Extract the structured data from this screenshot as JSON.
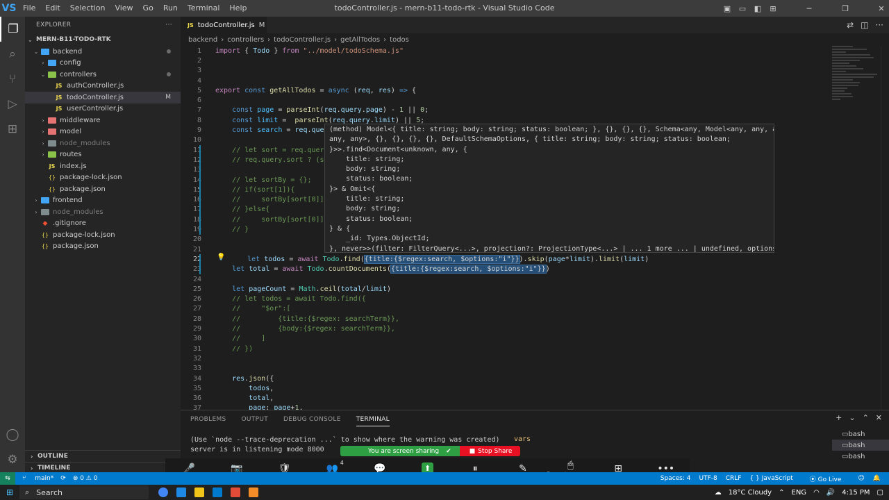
{
  "titlebar": {
    "logo": "VS",
    "menu": [
      "File",
      "Edit",
      "Selection",
      "View",
      "Go",
      "Run",
      "Terminal",
      "Help"
    ],
    "title": "todoController.js - mern-b11-todo-rtk - Visual Studio Code"
  },
  "sidebar": {
    "header": "EXPLORER",
    "root": "MERN-B11-TODO-RTK",
    "tree": [
      {
        "label": "backend",
        "kind": "folder",
        "color": "blue",
        "depth": 1,
        "open": true,
        "dot": true
      },
      {
        "label": "config",
        "kind": "folder",
        "color": "blue",
        "depth": 2,
        "open": false
      },
      {
        "label": "controllers",
        "kind": "folder",
        "color": "green",
        "depth": 2,
        "open": true,
        "dot": true
      },
      {
        "label": "authController.js",
        "kind": "js",
        "depth": 3
      },
      {
        "label": "todoController.js",
        "kind": "js",
        "depth": 3,
        "selected": true,
        "marker": "M"
      },
      {
        "label": "userController.js",
        "kind": "js",
        "depth": 3
      },
      {
        "label": "middleware",
        "kind": "folder",
        "color": "red",
        "depth": 2,
        "open": false
      },
      {
        "label": "model",
        "kind": "folder",
        "color": "red",
        "depth": 2,
        "open": false
      },
      {
        "label": "node_modules",
        "kind": "folder",
        "color": "gray",
        "depth": 2,
        "open": false,
        "dim": true
      },
      {
        "label": "routes",
        "kind": "folder",
        "color": "green",
        "depth": 2,
        "open": false
      },
      {
        "label": "index.js",
        "kind": "js",
        "depth": 2
      },
      {
        "label": "package-lock.json",
        "kind": "json",
        "depth": 2
      },
      {
        "label": "package.json",
        "kind": "json",
        "depth": 2
      },
      {
        "label": "frontend",
        "kind": "folder",
        "color": "blue",
        "depth": 1,
        "open": false
      },
      {
        "label": "node_modules",
        "kind": "folder",
        "color": "gray",
        "depth": 1,
        "open": false,
        "dim": true
      },
      {
        "label": ".gitignore",
        "kind": "git",
        "depth": 1
      },
      {
        "label": "package-lock.json",
        "kind": "json",
        "depth": 1
      },
      {
        "label": "package.json",
        "kind": "json",
        "depth": 1
      }
    ],
    "outline": "OUTLINE",
    "timeline": "TIMELINE"
  },
  "tab": {
    "label": "todoController.js",
    "modified": "M"
  },
  "breadcrumb": [
    "backend",
    "controllers",
    "todoController.js",
    "getAllTodos",
    "todos"
  ],
  "editor": {
    "lines": [
      {
        "n": "1",
        "tokens": [
          [
            "kw",
            "import "
          ],
          [
            "",
            "{ "
          ],
          [
            "vr",
            "Todo"
          ],
          [
            "",
            " } "
          ],
          [
            "kw",
            "from "
          ],
          [
            "st",
            "\"../model/todoSchema.js\""
          ]
        ]
      },
      {
        "n": "2",
        "tokens": []
      },
      {
        "n": "3",
        "tokens": []
      },
      {
        "n": "4",
        "tokens": []
      },
      {
        "n": "5",
        "tokens": [
          [
            "kw",
            "export "
          ],
          [
            "kb",
            "const "
          ],
          [
            "fn",
            "getAllTodos"
          ],
          [
            "",
            " = "
          ],
          [
            "kb",
            "async "
          ],
          [
            "",
            "("
          ],
          [
            "vr",
            "req"
          ],
          [
            ", "
          ],
          [
            "vr",
            "res"
          ],
          [
            ") "
          ],
          [
            "kb",
            "=> "
          ],
          [
            "",
            "{"
          ]
        ]
      },
      {
        "n": "6",
        "tokens": []
      },
      {
        "n": "7",
        "tokens": [
          [
            "",
            "    "
          ],
          [
            "kb",
            "const "
          ],
          [
            "cn",
            "page"
          ],
          [
            "",
            " = "
          ],
          [
            "fn",
            "parseInt"
          ],
          [
            "",
            "("
          ],
          [
            "vr",
            "req"
          ],
          [
            "",
            "."
          ],
          [
            "vr",
            "query"
          ],
          [
            "",
            "."
          ],
          [
            "vr",
            "page"
          ],
          [
            ") - "
          ],
          [
            "nm",
            "1"
          ],
          [
            "",
            " || "
          ],
          [
            "nm",
            "0"
          ],
          [
            ";"
          ]
        ]
      },
      {
        "n": "8",
        "tokens": [
          [
            "",
            "    "
          ],
          [
            "kb",
            "const "
          ],
          [
            "cn",
            "limit"
          ],
          [
            "",
            " =  "
          ],
          [
            "fn",
            "parseInt"
          ],
          [
            "",
            "("
          ],
          [
            "vr",
            "req"
          ],
          [
            "",
            "."
          ],
          [
            "vr",
            "query"
          ],
          [
            "",
            "."
          ],
          [
            "vr",
            "limit"
          ],
          [
            ") || "
          ],
          [
            "nm",
            "5"
          ],
          [
            ";"
          ]
        ]
      },
      {
        "n": "9",
        "tokens": [
          [
            "",
            "    "
          ],
          [
            "kb",
            "const "
          ],
          [
            "cn",
            "search"
          ],
          [
            "",
            " = "
          ],
          [
            "vr",
            "req"
          ],
          [
            "",
            "."
          ],
          [
            "vr",
            "quer"
          ]
        ]
      },
      {
        "n": "10",
        "tokens": []
      },
      {
        "n": "11",
        "tokens": [
          [
            "cm",
            "    // let sort = req.query"
          ]
        ]
      },
      {
        "n": "12",
        "tokens": [
          [
            "cm",
            "    // req.query.sort ? (so"
          ]
        ]
      },
      {
        "n": "13",
        "tokens": []
      },
      {
        "n": "14",
        "tokens": [
          [
            "cm",
            "    // let sortBy = {};"
          ]
        ]
      },
      {
        "n": "15",
        "tokens": [
          [
            "cm",
            "    // if(sort[1]){"
          ]
        ]
      },
      {
        "n": "16",
        "tokens": [
          [
            "cm",
            "    //     sortBy[sort[0]]"
          ]
        ]
      },
      {
        "n": "17",
        "tokens": [
          [
            "cm",
            "    // }else{"
          ]
        ]
      },
      {
        "n": "18",
        "tokens": [
          [
            "cm",
            "    //     sortBy[sort[0]]"
          ]
        ]
      },
      {
        "n": "19",
        "tokens": [
          [
            "cm",
            "    // }"
          ]
        ]
      },
      {
        "n": "20",
        "tokens": []
      },
      {
        "n": "21",
        "tokens": []
      },
      {
        "n": "22",
        "tokens": [
          [
            "",
            "    "
          ],
          [
            "kb",
            "let "
          ],
          [
            "vr",
            "todos"
          ],
          [
            "",
            " = "
          ],
          [
            "kw",
            "await "
          ],
          [
            "ty",
            "Todo"
          ],
          [
            "",
            "."
          ],
          [
            "fn",
            "find"
          ],
          [
            "",
            "("
          ],
          [
            "hl",
            "{title:{$regex:search, $options:\"i\"}}"
          ],
          [
            ")."
          ],
          [
            "fn",
            "skip"
          ],
          [
            "",
            "("
          ],
          [
            "vr",
            "page"
          ],
          [
            "",
            "*"
          ],
          [
            "vr",
            "limit"
          ],
          [
            ")."
          ],
          [
            "fn",
            "limit"
          ],
          [
            "",
            "("
          ],
          [
            "vr",
            "limit"
          ],
          [
            ")"
          ]
        ]
      },
      {
        "n": "23",
        "tokens": [
          [
            "",
            "    "
          ],
          [
            "kb",
            "let "
          ],
          [
            "vr",
            "total"
          ],
          [
            "",
            " = "
          ],
          [
            "kw",
            "await "
          ],
          [
            "ty",
            "Todo"
          ],
          [
            "",
            "."
          ],
          [
            "fn",
            "countDocuments"
          ],
          [
            "",
            "("
          ],
          [
            "hl",
            "{title:{$regex:search, $options:\"i\"}}"
          ],
          [
            ")"
          ]
        ]
      },
      {
        "n": "24",
        "tokens": []
      },
      {
        "n": "25",
        "tokens": [
          [
            "",
            "    "
          ],
          [
            "kb",
            "let "
          ],
          [
            "vr",
            "pageCount"
          ],
          [
            "",
            " = "
          ],
          [
            "ty",
            "Math"
          ],
          [
            "",
            "."
          ],
          [
            "fn",
            "ceil"
          ],
          [
            "",
            "("
          ],
          [
            "vr",
            "total"
          ],
          [
            "",
            "/"
          ],
          [
            "vr",
            "limit"
          ],
          [
            ")"
          ]
        ]
      },
      {
        "n": "26",
        "tokens": [
          [
            "cm",
            "    // let todos = await Todo.find({"
          ]
        ]
      },
      {
        "n": "27",
        "tokens": [
          [
            "cm",
            "    //     \"$or\":["
          ]
        ]
      },
      {
        "n": "28",
        "tokens": [
          [
            "cm",
            "    //         {title:{$regex: searchTerm}},"
          ]
        ]
      },
      {
        "n": "29",
        "tokens": [
          [
            "cm",
            "    //         {body:{$regex: searchTerm}},"
          ]
        ]
      },
      {
        "n": "30",
        "tokens": [
          [
            "cm",
            "    //     ]"
          ]
        ]
      },
      {
        "n": "31",
        "tokens": [
          [
            "cm",
            "    // })"
          ]
        ]
      },
      {
        "n": "32",
        "tokens": []
      },
      {
        "n": "33",
        "tokens": []
      },
      {
        "n": "34",
        "tokens": [
          [
            "",
            "    "
          ],
          [
            "vr",
            "res"
          ],
          [
            "",
            "."
          ],
          [
            "fn",
            "json"
          ],
          [
            "",
            "({"
          ]
        ]
      },
      {
        "n": "35",
        "tokens": [
          [
            "",
            "        "
          ],
          [
            "vr",
            "todos"
          ],
          [
            ","
          ]
        ]
      },
      {
        "n": "36",
        "tokens": [
          [
            "",
            "        "
          ],
          [
            "vr",
            "total"
          ],
          [
            ","
          ]
        ]
      },
      {
        "n": "37",
        "tokens": [
          [
            "",
            "        "
          ],
          [
            "vr",
            "page"
          ],
          [
            ": "
          ],
          [
            "vr",
            "page"
          ],
          [
            "",
            "+"
          ],
          [
            "nm",
            "1"
          ],
          [
            ","
          ]
        ]
      }
    ],
    "current_line": "22",
    "hover": [
      "(method) Model<{ title: string; body: string; status: boolean; }, {}, {}, {}, Schema<any, Model<any, any, any,",
      "any, any>, {}, {}, {}, {}, DefaultSchemaOptions, { title: string; body: string; status: boolean;",
      "}>>.find<Document<unknown, any, {",
      "    title: string;",
      "    body: string;",
      "    status: boolean;",
      "}> & Omit<{",
      "    title: string;",
      "    body: string;",
      "    status: boolean;",
      "} & {",
      "    _id: Types.ObjectId;",
      "}, never>>(filter: FilterQuery<...>, projection?: ProjectionType<...> | ... 1 more ... | undefined, options?:"
    ]
  },
  "panel": {
    "tabs": [
      "PROBLEMS",
      "OUTPUT",
      "DEBUG CONSOLE",
      "TERMINAL"
    ],
    "active": "TERMINAL",
    "terminal_lines": [
      "(Use `node --trace-deprecation ...` to show where the warning was created)",
      "server is in listening mode 8000"
    ],
    "side_text": "vars",
    "terminals": [
      "bash",
      "bash",
      "bash"
    ],
    "controls": [
      "+",
      "⌄",
      "⌃",
      "✕"
    ]
  },
  "share": {
    "status": "You are screen sharing",
    "stop": "Stop Share"
  },
  "zoom": [
    {
      "label": "Mute",
      "icon": "🎤"
    },
    {
      "label": "Start Video",
      "icon": "📷"
    },
    {
      "label": "Security",
      "icon": "🛡"
    },
    {
      "label": "Participants",
      "icon": "👥",
      "count": "4"
    },
    {
      "label": "Chat",
      "icon": "💬"
    },
    {
      "label": "New Share",
      "icon": "⬆"
    },
    {
      "label": "Pause Share",
      "icon": "⏸"
    },
    {
      "label": "Annotate",
      "icon": "✎"
    },
    {
      "label": "Remote Control",
      "icon": "🖱"
    },
    {
      "label": "Apps",
      "icon": "⊞"
    },
    {
      "label": "More",
      "icon": "•••"
    }
  ],
  "status": {
    "branch": "main*",
    "problems": "⊗ 0 ⚠ 0",
    "spaces": "Spaces: 4",
    "encoding": "UTF-8",
    "eol": "CRLF",
    "lang": "JavaScript",
    "golive": "Go Live"
  },
  "taskbar": {
    "search": "Search",
    "weather": "18°C  Cloudy",
    "lang": "ENG",
    "time": "4:15 PM"
  }
}
